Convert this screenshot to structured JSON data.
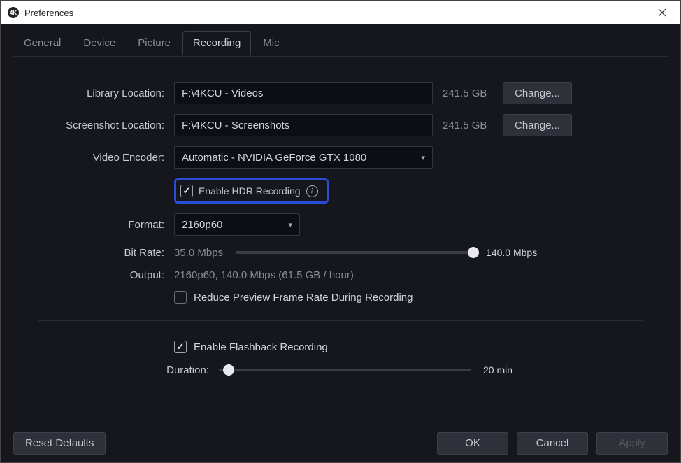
{
  "window": {
    "title": "Preferences",
    "logo_text": "4K"
  },
  "tabs": [
    "General",
    "Device",
    "Picture",
    "Recording",
    "Mic"
  ],
  "active_tab": "Recording",
  "recording": {
    "library_location": {
      "label": "Library Location:",
      "value": "F:\\4KCU - Videos",
      "size": "241.5 GB",
      "change": "Change..."
    },
    "screenshot_location": {
      "label": "Screenshot Location:",
      "value": "F:\\4KCU - Screenshots",
      "size": "241.5 GB",
      "change": "Change..."
    },
    "video_encoder": {
      "label": "Video Encoder:",
      "value": "Automatic - NVIDIA GeForce GTX 1080"
    },
    "hdr": {
      "checked": true,
      "label": "Enable HDR Recording"
    },
    "format": {
      "label": "Format:",
      "value": "2160p60"
    },
    "bitrate": {
      "label": "Bit Rate:",
      "min_label": "35.0 Mbps",
      "max_label": "140.0 Mbps",
      "position_pct": 100
    },
    "output": {
      "label": "Output:",
      "text": "2160p60, 140.0 Mbps (61.5 GB / hour)"
    },
    "reduce_preview": {
      "checked": false,
      "label": "Reduce Preview Frame Rate During Recording"
    },
    "flashback": {
      "checked": true,
      "label": "Enable Flashback Recording"
    },
    "duration": {
      "label": "Duration:",
      "value_label": "20 min",
      "position_pct": 4
    }
  },
  "buttons": {
    "reset": "Reset Defaults",
    "ok": "OK",
    "cancel": "Cancel",
    "apply": "Apply"
  }
}
